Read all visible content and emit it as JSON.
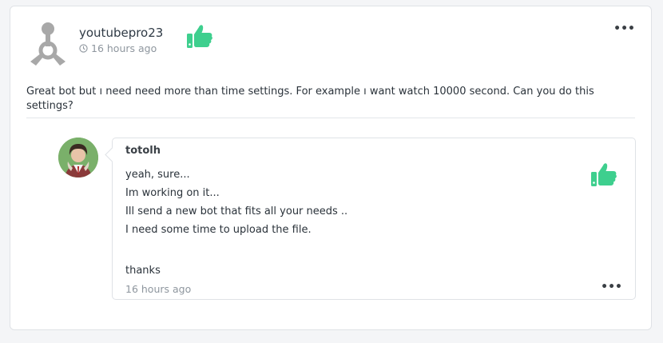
{
  "post": {
    "username": "youtubepro23",
    "time": "16 hours ago",
    "text": "Great bot but ı need need more than time settings. For example ı want watch 10000 second. Can you do this settings?",
    "menu_label": "•••"
  },
  "reply": {
    "username": "totolh",
    "lines": [
      "yeah, sure...",
      "Im working on it...",
      "Ill send a new bot that fits all your needs ..",
      "I need some time to upload the file."
    ],
    "signoff": "thanks",
    "time": "16 hours ago",
    "menu_label": "•••"
  },
  "colors": {
    "like": "#3ecf8e",
    "muted": "#8e969e",
    "border": "#dfe2e6"
  },
  "icons": {
    "like": "thumbs-up-icon",
    "clock": "clock-icon",
    "menu": "more-options-icon",
    "avatar": "default-user-avatar-icon"
  }
}
